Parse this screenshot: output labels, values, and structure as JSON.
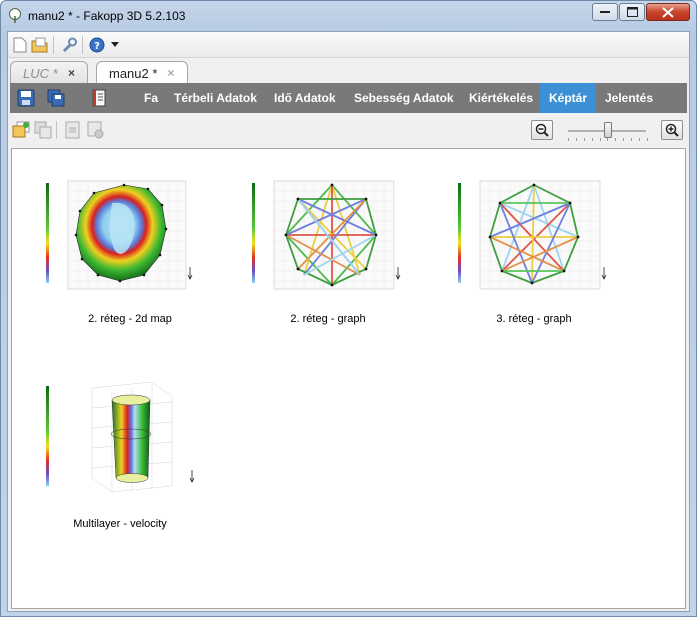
{
  "window": {
    "title": "manu2 * - Fakopp 3D 5.2.103"
  },
  "toolbar": {
    "icons": [
      "new-icon",
      "open-icon",
      "wrench-icon",
      "help-icon",
      "dropdown-arrow-icon"
    ]
  },
  "tabs": [
    {
      "label": "LUC *",
      "close": "×",
      "active": false
    },
    {
      "label": "manu2 *",
      "close": "×",
      "active": true
    }
  ],
  "menu": {
    "items": [
      "Fa",
      "Térbeli Adatok",
      "Idő Adatok",
      "Sebesség Adatok",
      "Kiértékelés",
      "Képtár",
      "Jelentés"
    ],
    "active": "Képtár",
    "accent": "#3d8fd6",
    "bar_color": "#797979"
  },
  "zoom": {
    "level": 0.5
  },
  "gallery": {
    "items": [
      {
        "caption": "2. réteg - 2d map",
        "type": "map"
      },
      {
        "caption": "2. réteg - graph",
        "type": "graph"
      },
      {
        "caption": "3. réteg - graph",
        "type": "graph"
      },
      {
        "caption": "Multilayer - velocity",
        "type": "3d"
      }
    ]
  }
}
